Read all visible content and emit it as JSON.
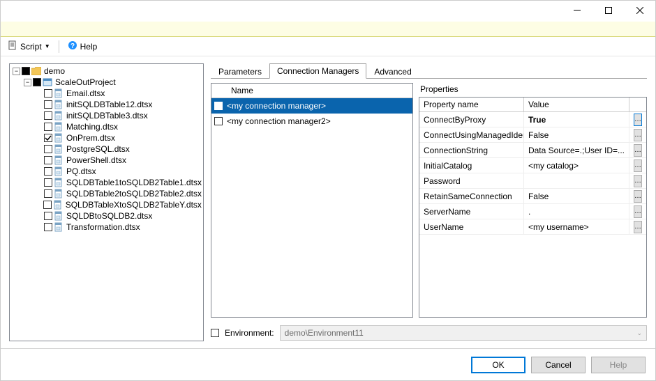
{
  "toolbar": {
    "script_label": "Script",
    "help_label": "Help"
  },
  "tree": {
    "root": "demo",
    "project": "ScaleOutProject",
    "items": [
      {
        "label": "Email.dtsx",
        "checked": false
      },
      {
        "label": "initSQLDBTable12.dtsx",
        "checked": false
      },
      {
        "label": "initSQLDBTable3.dtsx",
        "checked": false
      },
      {
        "label": "Matching.dtsx",
        "checked": false
      },
      {
        "label": "OnPrem.dtsx",
        "checked": true
      },
      {
        "label": "PostgreSQL.dtsx",
        "checked": false
      },
      {
        "label": "PowerShell.dtsx",
        "checked": false
      },
      {
        "label": "PQ.dtsx",
        "checked": false
      },
      {
        "label": "SQLDBTable1toSQLDB2Table1.dtsx",
        "checked": false
      },
      {
        "label": "SQLDBTable2toSQLDB2Table2.dtsx",
        "checked": false
      },
      {
        "label": "SQLDBTableXtoSQLDB2TableY.dtsx",
        "checked": false
      },
      {
        "label": "SQLDBtoSQLDB2.dtsx",
        "checked": false
      },
      {
        "label": "Transformation.dtsx",
        "checked": false
      }
    ]
  },
  "tabs": {
    "parameters": "Parameters",
    "connection_managers": "Connection Managers",
    "advanced": "Advanced"
  },
  "conn_list": {
    "header": "Name",
    "items": [
      {
        "label": "<my connection manager>",
        "selected": true
      },
      {
        "label": "<my connection manager2>",
        "selected": false
      }
    ]
  },
  "properties": {
    "title": "Properties",
    "col_name": "Property name",
    "col_value": "Value",
    "rows": [
      {
        "name": "ConnectByProxy",
        "value": "True",
        "selected": true
      },
      {
        "name": "ConnectUsingManagedIdentity",
        "value": "False"
      },
      {
        "name": "ConnectionString",
        "value": "Data Source=.;User ID=..."
      },
      {
        "name": "InitialCatalog",
        "value": "<my catalog>"
      },
      {
        "name": "Password",
        "value": ""
      },
      {
        "name": "RetainSameConnection",
        "value": "False"
      },
      {
        "name": "ServerName",
        "value": "."
      },
      {
        "name": "UserName",
        "value": "<my username>"
      }
    ]
  },
  "environment": {
    "label": "Environment:",
    "value": "demo\\Environment11"
  },
  "footer": {
    "ok": "OK",
    "cancel": "Cancel",
    "help": "Help"
  }
}
